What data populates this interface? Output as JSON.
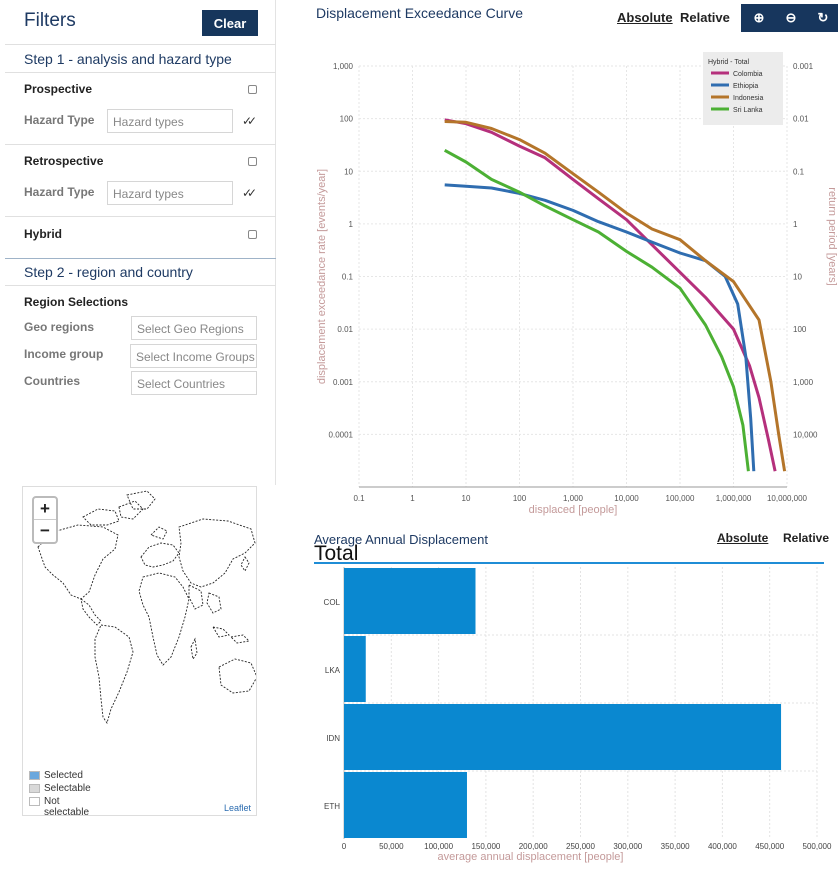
{
  "filters": {
    "title": "Filters",
    "clear_label": "Clear",
    "step1_title": "Step 1 - analysis and hazard type",
    "prospective_label": "Prospective",
    "retrospective_label": "Retrospective",
    "hybrid_label": "Hybrid",
    "hazard_type_label": "Hazard Type",
    "hazard_placeholder": "Hazard types",
    "step2_title": "Step 2 - region and country",
    "region_selections_label": "Region Selections",
    "geo_regions_label": "Geo regions",
    "geo_regions_placeholder": "Select Geo Regions",
    "income_group_label": "Income group",
    "income_group_placeholder": "Select Income Groups",
    "countries_label": "Countries",
    "countries_placeholder": "Select Countries"
  },
  "map": {
    "zoom_in": "+",
    "zoom_out": "−",
    "legend": [
      {
        "label": "Selected",
        "color": "#6aa7dd"
      },
      {
        "label": "Selectable",
        "color": "#d9d9d9"
      },
      {
        "label": "Not selectable",
        "color": "#ffffff"
      }
    ],
    "attribution": "Leaflet"
  },
  "exceedance": {
    "title": "Displacement Exceedance Curve",
    "absolute_label": "Absolute",
    "relative_label": "Relative",
    "tools": [
      {
        "icon": "zoom-in-icon",
        "glyph": "⊕"
      },
      {
        "icon": "zoom-out-icon",
        "glyph": "⊖"
      },
      {
        "icon": "reset-icon",
        "glyph": "↻"
      }
    ]
  },
  "aad": {
    "title": "Average Annual Displacement",
    "absolute_label": "Absolute",
    "relative_label": "Relative",
    "total_label": "Total"
  },
  "chart_data": [
    {
      "type": "line",
      "title": "Displacement Exceedance Curve",
      "xlabel": "displaced [people]",
      "ylabel": "displacement exceedance rate [events/year]",
      "y2label": "return period [years]",
      "xscale": "log",
      "yscale": "log",
      "xlim": [
        0.1,
        10000000
      ],
      "ylim": [
        1e-05,
        1000
      ],
      "x_ticks": [
        "0.1",
        "1",
        "10",
        "100",
        "1,000",
        "10,000",
        "100,000",
        "1,000,000",
        "10,000,000"
      ],
      "y_ticks": [
        "1,000",
        "100",
        "10",
        "1",
        "0.1",
        "0.01",
        "0.001",
        "0.0001"
      ],
      "y2_ticks": [
        "0.001",
        "0.01",
        "0.1",
        "1",
        "10",
        "100",
        "1,000",
        "10,000"
      ],
      "grid": true,
      "legend_title": "Hybrid - Total",
      "legend_position": "top-right",
      "series": [
        {
          "name": "Colombia",
          "color": "#b5307c",
          "points": [
            [
              4,
              95
            ],
            [
              10,
              80
            ],
            [
              30,
              55
            ],
            [
              100,
              30
            ],
            [
              300,
              18
            ],
            [
              1000,
              7
            ],
            [
              3000,
              3
            ],
            [
              10000,
              1.2
            ],
            [
              30000,
              0.4
            ],
            [
              100000,
              0.12
            ],
            [
              300000,
              0.04
            ],
            [
              1000000,
              0.01
            ],
            [
              2000000,
              0.002
            ],
            [
              3000000,
              0.0005
            ],
            [
              4500000,
              8e-05
            ],
            [
              6000000,
              2e-05
            ]
          ]
        },
        {
          "name": "Ethiopia",
          "color": "#2f6db0",
          "points": [
            [
              4,
              5.5
            ],
            [
              10,
              5.2
            ],
            [
              30,
              4.8
            ],
            [
              100,
              3.8
            ],
            [
              300,
              2.8
            ],
            [
              1000,
              1.8
            ],
            [
              3000,
              1.1
            ],
            [
              10000,
              0.7
            ],
            [
              30000,
              0.45
            ],
            [
              100000,
              0.28
            ],
            [
              300000,
              0.2
            ],
            [
              700000,
              0.1
            ],
            [
              1200000,
              0.03
            ],
            [
              1700000,
              0.003
            ],
            [
              2100000,
              0.0002
            ],
            [
              2400000,
              2e-05
            ]
          ]
        },
        {
          "name": "Indonesia",
          "color": "#b4752a",
          "points": [
            [
              4,
              88
            ],
            [
              10,
              85
            ],
            [
              30,
              65
            ],
            [
              100,
              40
            ],
            [
              300,
              22
            ],
            [
              1000,
              9
            ],
            [
              3000,
              4
            ],
            [
              10000,
              1.6
            ],
            [
              30000,
              0.8
            ],
            [
              100000,
              0.5
            ],
            [
              300000,
              0.2
            ],
            [
              1000000,
              0.08
            ],
            [
              3000000,
              0.015
            ],
            [
              5000000,
              0.001
            ],
            [
              7000000,
              0.0001
            ],
            [
              9000000,
              2e-05
            ]
          ]
        },
        {
          "name": "Sri Lanka",
          "color": "#4cb034",
          "points": [
            [
              4,
              25
            ],
            [
              10,
              15
            ],
            [
              30,
              7
            ],
            [
              100,
              4
            ],
            [
              300,
              2.2
            ],
            [
              1000,
              1.2
            ],
            [
              3000,
              0.7
            ],
            [
              10000,
              0.3
            ],
            [
              30000,
              0.15
            ],
            [
              100000,
              0.06
            ],
            [
              300000,
              0.012
            ],
            [
              600000,
              0.003
            ],
            [
              1000000,
              0.0008
            ],
            [
              1500000,
              0.00015
            ],
            [
              1900000,
              2e-05
            ]
          ]
        }
      ]
    },
    {
      "type": "bar",
      "orientation": "horizontal",
      "title": "Average Annual Displacement",
      "subtitle": "Total",
      "categories": [
        "COL",
        "LKA",
        "IDN",
        "ETH"
      ],
      "values": [
        139000,
        23000,
        462000,
        130000
      ],
      "xlabel": "average annual displacement [people]",
      "xlim": [
        0,
        500000
      ],
      "x_ticks": [
        "0",
        "50,000",
        "100,000",
        "150,000",
        "200,000",
        "250,000",
        "300,000",
        "350,000",
        "400,000",
        "450,000",
        "500,000"
      ],
      "bar_color": "#0a88d0",
      "grid": true
    }
  ]
}
